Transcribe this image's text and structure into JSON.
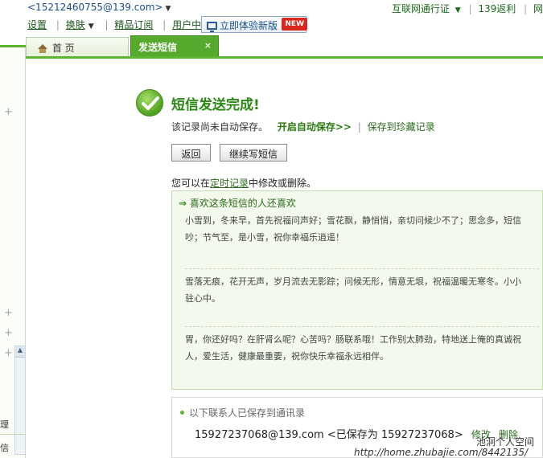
{
  "header": {
    "account": "<15212460755@139.com>",
    "nav": [
      {
        "label": "设置",
        "has_caret": false
      },
      {
        "label": "换肤",
        "has_caret": true
      },
      {
        "label": "精品订阅",
        "has_caret": false
      },
      {
        "label": "用户中心",
        "has_caret": false
      }
    ],
    "new_version_label": "立即体验新版",
    "new_badge": "NEW",
    "right_links": [
      "互联网通行证",
      "139返利",
      "网"
    ]
  },
  "tabs": [
    {
      "label": "首 页",
      "active": false
    },
    {
      "label": "发送短信",
      "active": true,
      "close": "×"
    }
  ],
  "left": {
    "side_texts": [
      "理",
      "信"
    ]
  },
  "main": {
    "title": "短信发送完成!",
    "subtitle_prefix": "该记录尚未自动保存。",
    "auto_save_link": "开启自动保存>>",
    "save_fav_link": "保存到珍藏记录",
    "buttons": {
      "back": "返回",
      "continue": "继续写短信"
    },
    "note_prefix": "您可以在",
    "note_link": "定时记录",
    "note_suffix": "中修改或删除。",
    "recommend": {
      "heading": "喜欢这条短信的人还喜欢",
      "items": [
        {
          "line1": "小雪到，冬来早，首先祝福问声好；雪花飘，静悄悄，亲切问候少不了；思念多，短信",
          "line2": "吵；节气至，是小雪，祝你幸福乐逍遥！"
        },
        {
          "line1": "雪落无痕，花开无声，岁月流去无影踪；问候无形，情意无垠，祝福温暖无寒冬。小小",
          "line2": "驻心中。"
        },
        {
          "line1": "胃，你还好吗？在肝肾么呢？心苦吗？肠联系哦！工作别太肺劲，特地送上俺的真诚祝",
          "line2": "人，爱生活，健康最重要，祝你快乐幸福永远相伴。"
        }
      ]
    },
    "saved": {
      "heading": "以下联系人已保存到通讯录",
      "contact": "15927237068@139.com <已保存为 15927237068>",
      "modify": "修改",
      "delete": "删除"
    }
  },
  "watermark": {
    "line1": "池洞个人空间",
    "line2": "http://home.zhubajie.com/8442135/"
  }
}
